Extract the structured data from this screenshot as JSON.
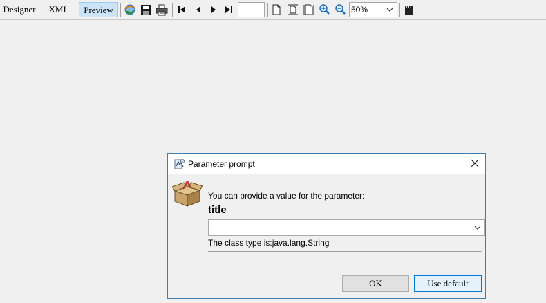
{
  "toolbar": {
    "tabs": [
      {
        "label": "Designer",
        "active": false
      },
      {
        "label": "XML",
        "active": false
      },
      {
        "label": "Preview",
        "active": true
      }
    ],
    "icons": [
      "refresh-icon",
      "save-icon",
      "print-icon",
      "first-page-icon",
      "previous-page-icon",
      "next-page-icon",
      "last-page-icon",
      "actual-size-icon",
      "fit-page-icon",
      "fit-width-icon",
      "zoom-in-icon",
      "zoom-out-icon",
      "clapper-icon"
    ],
    "page_number": "",
    "zoom": "50%"
  },
  "dialog": {
    "title": "Parameter prompt",
    "message": "You can provide a value for the parameter:",
    "parameter_name": "title",
    "input_value": "",
    "class_type": "The class type is:java.lang.String",
    "ok_label": "OK",
    "default_label": "Use default"
  },
  "colors": {
    "accent": "#0078d7",
    "active_tab": "#cce4f7",
    "dialog_border": "#3c7fb1"
  }
}
